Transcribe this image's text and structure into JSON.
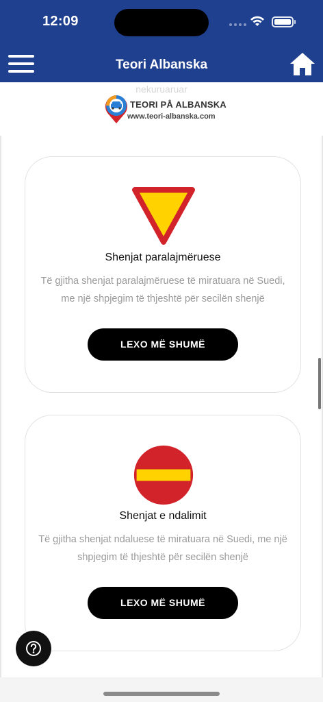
{
  "status_bar": {
    "time": "12:09"
  },
  "navbar": {
    "title": "Teori Albanska",
    "menu_icon": "hamburger-menu-icon",
    "home_icon": "home-icon"
  },
  "logo": {
    "ghost_text": "nekuruaruar",
    "title": "TEORI PÅ ALBANSKA",
    "url": "www.teori-albanska.com"
  },
  "cards": [
    {
      "icon": "warning-triangle-sign-icon",
      "title": "Shenjat paralajmëruese",
      "description": "Të gjitha shenjat paralajmëruese të miratuara në Suedi, me një shpjegim të thjeshtë për secilën shenjë",
      "button_label": "LEXO MË SHUMË"
    },
    {
      "icon": "no-entry-sign-icon",
      "title": "Shenjat e ndalimit",
      "description": "Të gjitha shenjat ndaluese të miratuara në Suedi, me një shpjegim të thjeshtë për secilën shenjë",
      "button_label": "LEXO MË SHUMË"
    }
  ],
  "help": {
    "icon": "question-mark-icon"
  },
  "colors": {
    "brand_blue": "#1f3f8f",
    "sign_red": "#d2232a",
    "sign_yellow": "#ffd200",
    "button_black": "#000000"
  }
}
